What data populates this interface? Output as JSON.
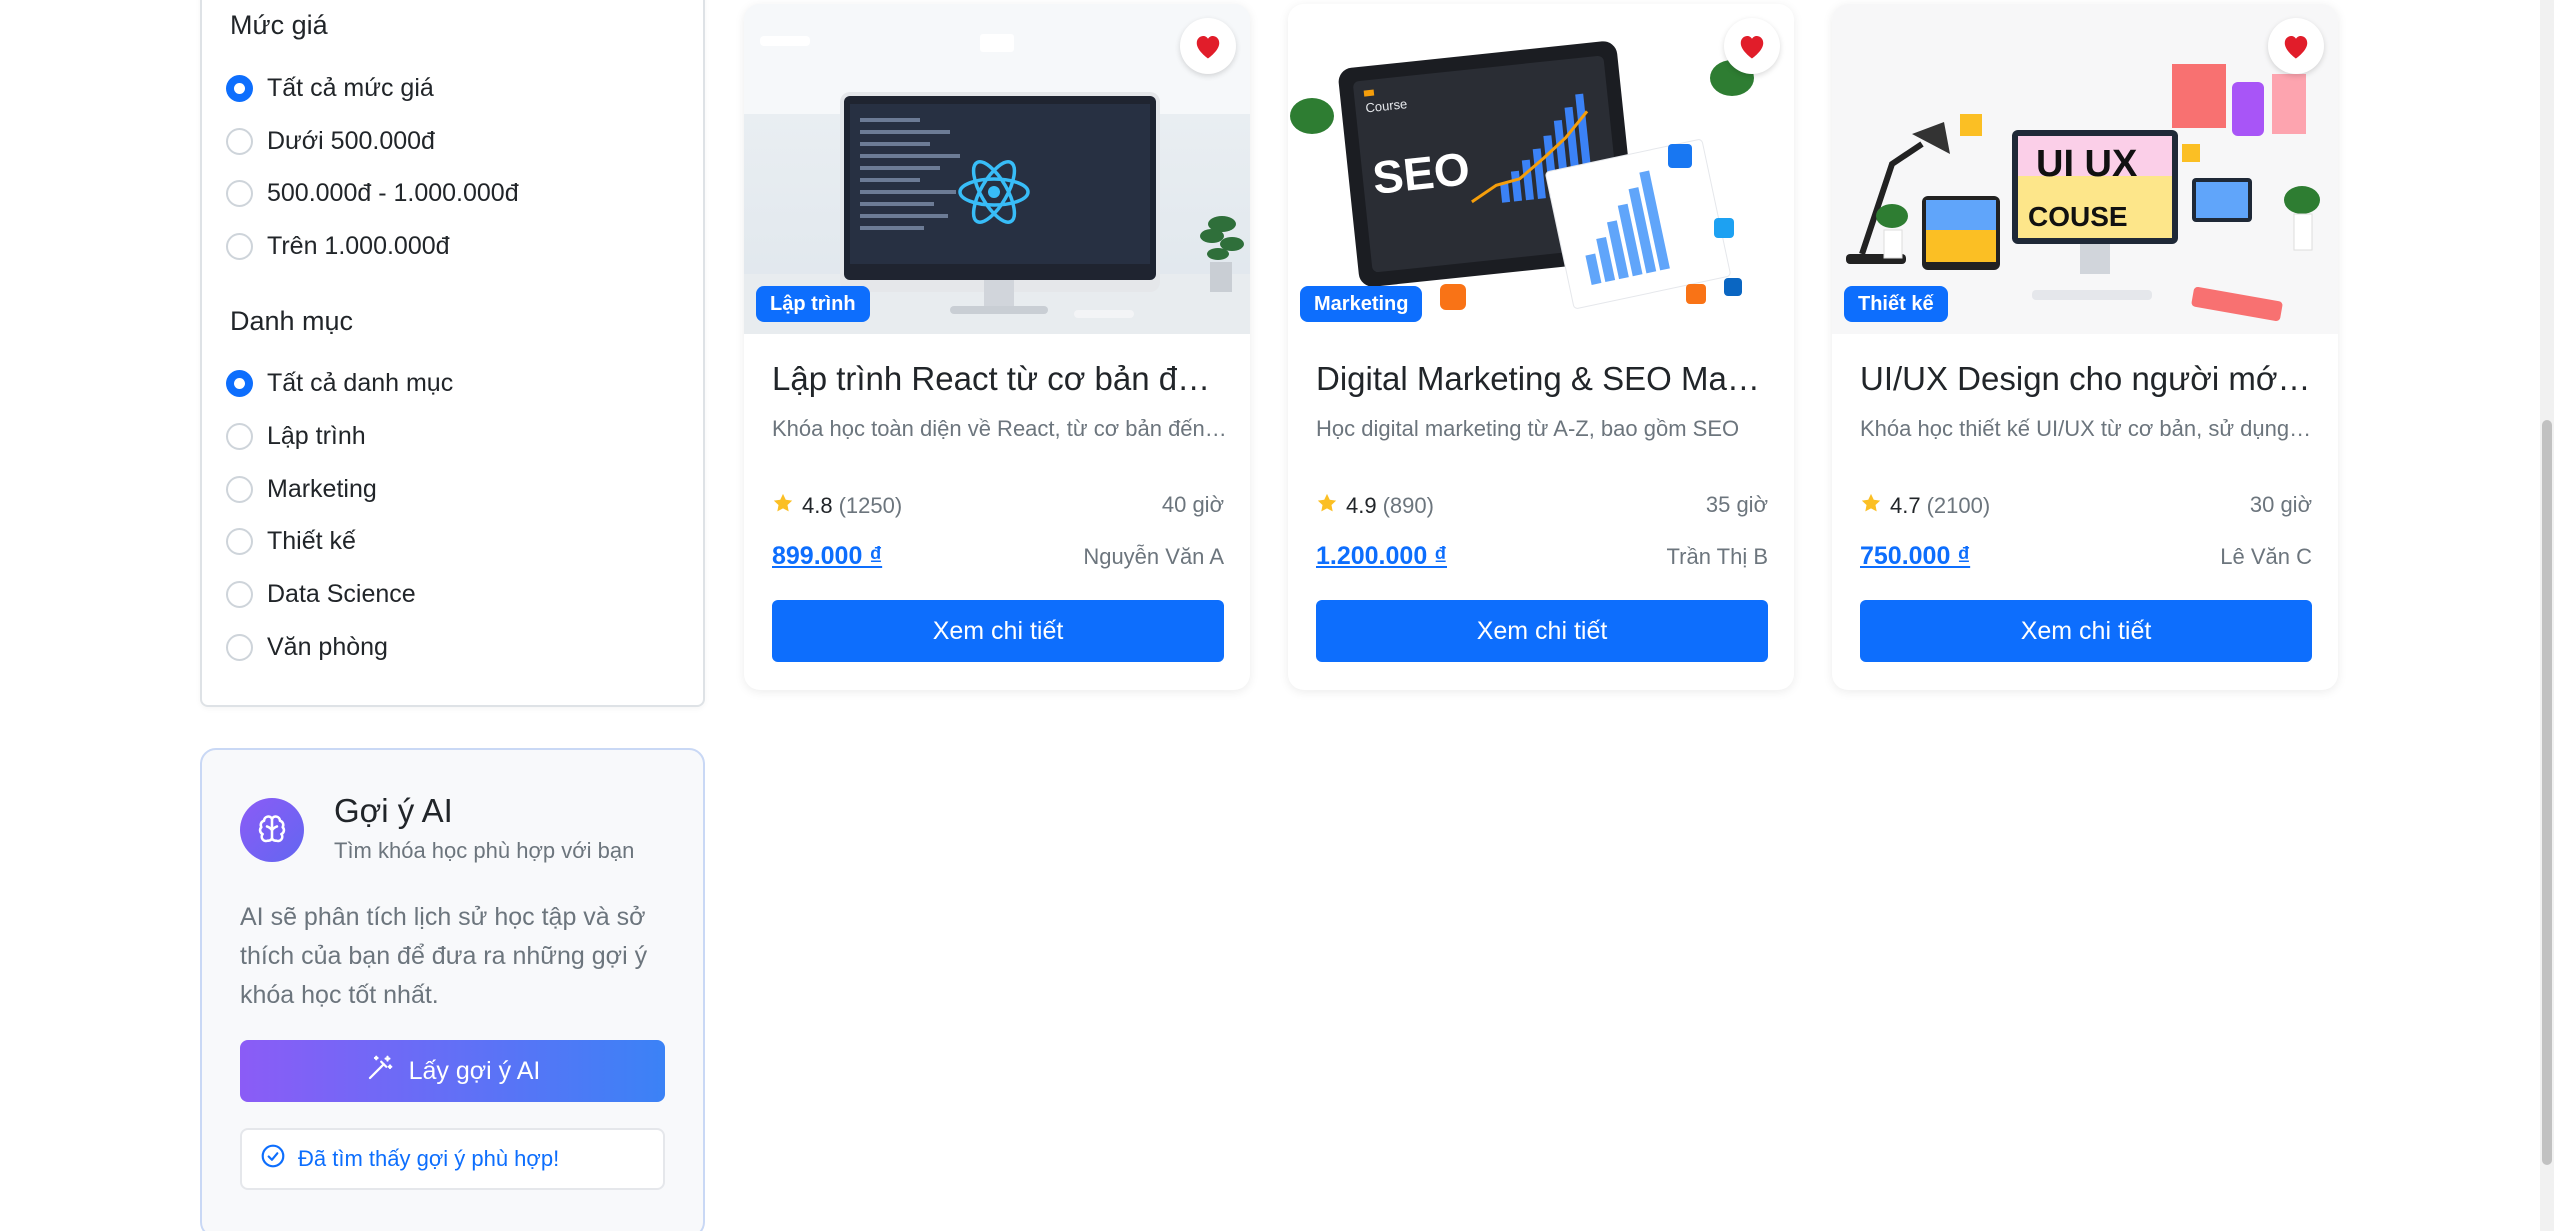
{
  "filters": {
    "price": {
      "title": "Mức giá",
      "options": [
        {
          "label": "Tất cả mức giá",
          "checked": true
        },
        {
          "label": "Dưới 500.000đ",
          "checked": false
        },
        {
          "label": "500.000đ - 1.000.000đ",
          "checked": false
        },
        {
          "label": "Trên 1.000.000đ",
          "checked": false
        }
      ]
    },
    "category": {
      "title": "Danh mục",
      "options": [
        {
          "label": "Tất cả danh mục",
          "checked": true
        },
        {
          "label": "Lập trình",
          "checked": false
        },
        {
          "label": "Marketing",
          "checked": false
        },
        {
          "label": "Thiết kế",
          "checked": false
        },
        {
          "label": "Data Science",
          "checked": false
        },
        {
          "label": "Văn phòng",
          "checked": false
        }
      ]
    }
  },
  "ai": {
    "icon": "brain-icon",
    "title": "Gợi ý AI",
    "subtitle": "Tìm khóa học phù hợp với bạn",
    "description": "AI sẽ phân tích lịch sử học tập và sở thích của bạn để đưa ra những gợi ý khóa học tốt nhất.",
    "button_label": "Lấy gợi ý AI",
    "button_icon": "magic-wand-icon",
    "result_text": "Đã tìm thấy gợi ý phù hợp!",
    "result_icon": "check-circle-icon"
  },
  "courses": [
    {
      "category": "Lập trình",
      "title": "Lập trình React từ cơ bản đến nâng cao",
      "description": "Khóa học toàn diện về React, từ cơ bản đến nâng cao",
      "rating": "4.8",
      "reviews": "(1250)",
      "hours": "40 giờ",
      "price": "899.000 ₫",
      "instructor": "Nguyễn Văn A",
      "button_label": "Xem chi tiết",
      "thumb_text": "",
      "favorite": true
    },
    {
      "category": "Marketing",
      "title": "Digital Marketing & SEO Master",
      "description": "Học digital marketing từ A-Z, bao gồm SEO",
      "rating": "4.9",
      "reviews": "(890)",
      "hours": "35 giờ",
      "price": "1.200.000 ₫",
      "instructor": "Trần Thị B",
      "button_label": "Xem chi tiết",
      "thumb_text": "SEO",
      "thumb_subtext": "Course",
      "favorite": true
    },
    {
      "category": "Thiết kế",
      "title": "UI/UX Design cho người mới bắt đầu",
      "description": "Khóa học thiết kế UI/UX từ cơ bản, sử dụng Figma",
      "rating": "4.7",
      "reviews": "(2100)",
      "hours": "30 giờ",
      "price": "750.000 ₫",
      "instructor": "Lê Văn C",
      "button_label": "Xem chi tiết",
      "thumb_text": "UI UX",
      "thumb_subtext": "COUSE",
      "favorite": true
    }
  ],
  "colors": {
    "primary": "#0d6efd",
    "star": "#fbbf24",
    "heart": "#e11d2a",
    "ai_gradient_start": "#8b5cf6",
    "ai_gradient_end": "#3b82f6"
  }
}
